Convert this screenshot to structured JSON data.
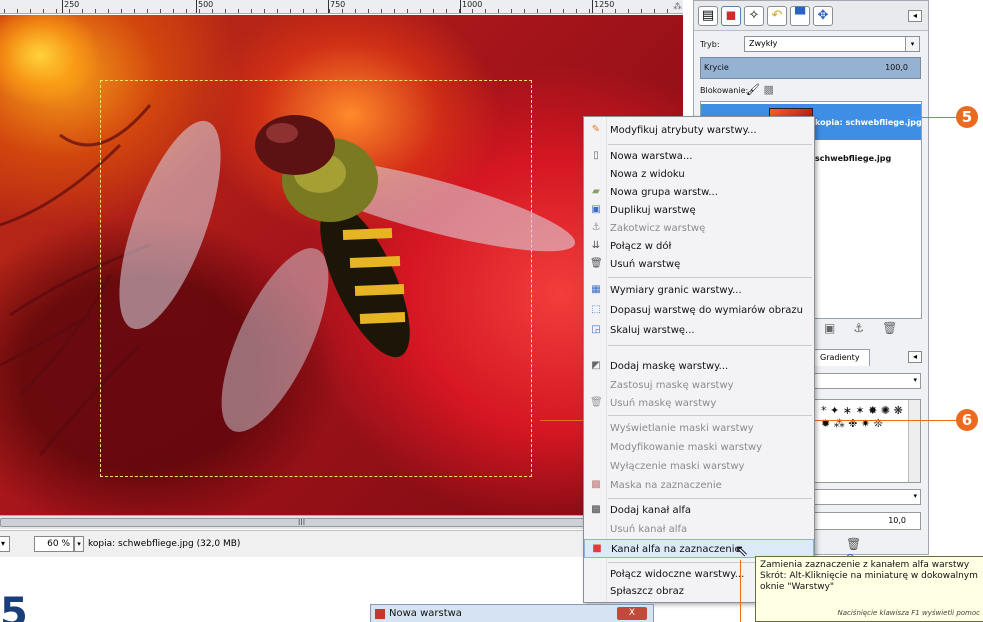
{
  "ruler": {
    "ticks": [
      "250",
      "500",
      "750",
      "1000",
      "1250"
    ]
  },
  "status": {
    "zoom": "60 %",
    "title": "kopia: schwebfliege.jpg (32,0 MB)",
    "grip": "III"
  },
  "layers_panel": {
    "mode_label": "Tryb:",
    "mode_value": "Zwykły",
    "opacity_label": "Krycie",
    "opacity_value": "100,0",
    "lock_label": "Blokowanie:",
    "layers": [
      "kopia: schwebfliege.jpg",
      "schwebfliege.jpg"
    ]
  },
  "brushes_panel": {
    "tab": "Gradienty",
    "spacing": "10,0"
  },
  "callouts": {
    "c5": "5",
    "c6": "6"
  },
  "context_menu": {
    "items": [
      {
        "label": "Modyfikuj atrybuty warstwy...",
        "icon": "edit-layer-icon",
        "disabled": false
      },
      {
        "label": "Nowa warstwa...",
        "icon": "new-layer-icon",
        "disabled": false
      },
      {
        "label": "Nowa z widoku",
        "icon": "",
        "disabled": false
      },
      {
        "label": "Nowa grupa warstw...",
        "icon": "folder-icon",
        "disabled": false
      },
      {
        "label": "Duplikuj warstwę",
        "icon": "duplicate-icon",
        "disabled": false
      },
      {
        "label": "Zakotwicz warstwę",
        "icon": "anchor-icon",
        "disabled": true
      },
      {
        "label": "Połącz w dół",
        "icon": "merge-down-icon",
        "disabled": false
      },
      {
        "label": "Usuń warstwę",
        "icon": "trash-icon",
        "disabled": false
      },
      {
        "label": "Wymiary granic warstwy...",
        "icon": "boundary-icon",
        "disabled": false
      },
      {
        "label": "Dopasuj warstwę do wymiarów obrazu",
        "icon": "fit-icon",
        "disabled": false
      },
      {
        "label": "Skaluj warstwę...",
        "icon": "scale-icon",
        "disabled": false
      },
      {
        "label": "Dodaj maskę warstwy...",
        "icon": "add-mask-icon",
        "disabled": false
      },
      {
        "label": "Zastosuj maskę warstwy",
        "icon": "",
        "disabled": true
      },
      {
        "label": "Usuń maskę warstwy",
        "icon": "trash-icon",
        "disabled": true
      },
      {
        "label": "Wyświetlanie maski warstwy",
        "icon": "",
        "disabled": true
      },
      {
        "label": "Modyfikowanie maski warstwy",
        "icon": "",
        "disabled": true
      },
      {
        "label": "Wyłączenie maski warstwy",
        "icon": "",
        "disabled": true
      },
      {
        "label": "Maska na zaznaczenie",
        "icon": "mask-icon",
        "disabled": true
      },
      {
        "label": "Dodaj kanał alfa",
        "icon": "alpha-icon",
        "disabled": false
      },
      {
        "label": "Usuń kanał alfa",
        "icon": "",
        "disabled": true
      },
      {
        "label": "Kanał alfa na zaznaczenie",
        "icon": "selection-icon",
        "disabled": false
      },
      {
        "label": "Połącz widoczne warstwy...",
        "icon": "",
        "disabled": false
      },
      {
        "label": "Spłaszcz obraz",
        "icon": "",
        "disabled": false
      }
    ]
  },
  "tooltip": {
    "line1": "Zamienia zaznaczenie z kanałem alfa warstwy",
    "line2": "Skrót: Alt-Kliknięcie na miniaturę w dokowalnym oknie \"Warstwy\"",
    "hint": "Naciśnięcie klawisza F1 wyświetli pomoc"
  },
  "bottom": {
    "big_number": "5",
    "dialog_title": "Nowa warstwa",
    "dialog_close": "X"
  }
}
